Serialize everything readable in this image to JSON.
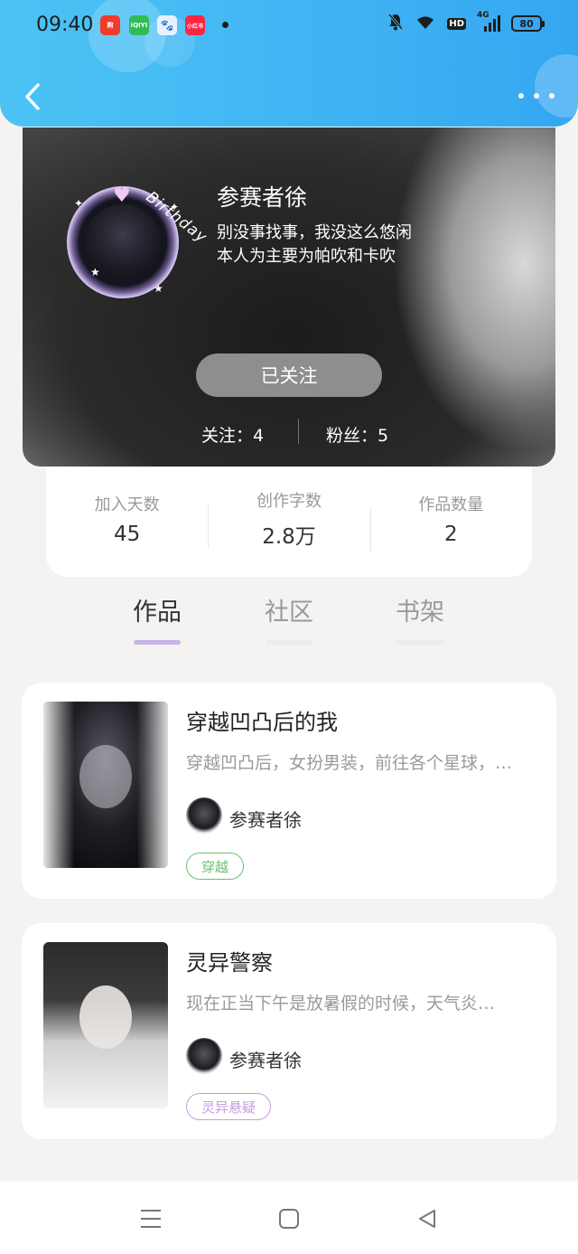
{
  "status_bar": {
    "time": "09:40",
    "apps": [
      {
        "name": "jingxi-app-icon",
        "label": "购",
        "color": "#ef3b2c"
      },
      {
        "name": "iqiyi-app-icon",
        "label": "iQIYI",
        "color": "#2fbd55"
      },
      {
        "name": "baidu-app-icon",
        "label": "🐾",
        "color": "#e8f1ff"
      },
      {
        "name": "xiaohongshu-app-icon",
        "label": "小红书",
        "color": "#ff2442"
      }
    ],
    "battery": "80",
    "network": "4G",
    "hd": "HD"
  },
  "header": {
    "back_icon": "chevron-left-icon",
    "more_icon": "more-dots-icon"
  },
  "profile": {
    "nickname": "参赛者徐",
    "bio_line1": "别没事找事，我没这么悠闲",
    "bio_line2": "本人为主要为帕吹和卡吹",
    "avatar_frame_text": "Birthday",
    "follow_button": "已关注",
    "following_label": "关注：4",
    "fans_label": "粉丝：5"
  },
  "stats": [
    {
      "label": "加入天数",
      "value": "45"
    },
    {
      "label": "创作字数",
      "value": "2.8万"
    },
    {
      "label": "作品数量",
      "value": "2"
    }
  ],
  "tabs": [
    {
      "label": "作品",
      "active": true
    },
    {
      "label": "社区",
      "active": false
    },
    {
      "label": "书架",
      "active": false
    }
  ],
  "books": [
    {
      "title": "穿越凹凸后的我",
      "description": "穿越凹凸后，女扮男装，前往各个星球，…",
      "author": "参赛者徐",
      "tag": "穿越",
      "tag_color": "#6cbf72"
    },
    {
      "title": "灵异警察",
      "description": "现在正当下午是放暑假的时候，天气炎…",
      "author": "参赛者徐",
      "tag": "灵异悬疑",
      "tag_color": "#c79be0"
    }
  ],
  "system_nav": {
    "menu_icon": "menu-icon",
    "home_icon": "home-square-icon",
    "back_icon": "back-triangle-icon"
  }
}
